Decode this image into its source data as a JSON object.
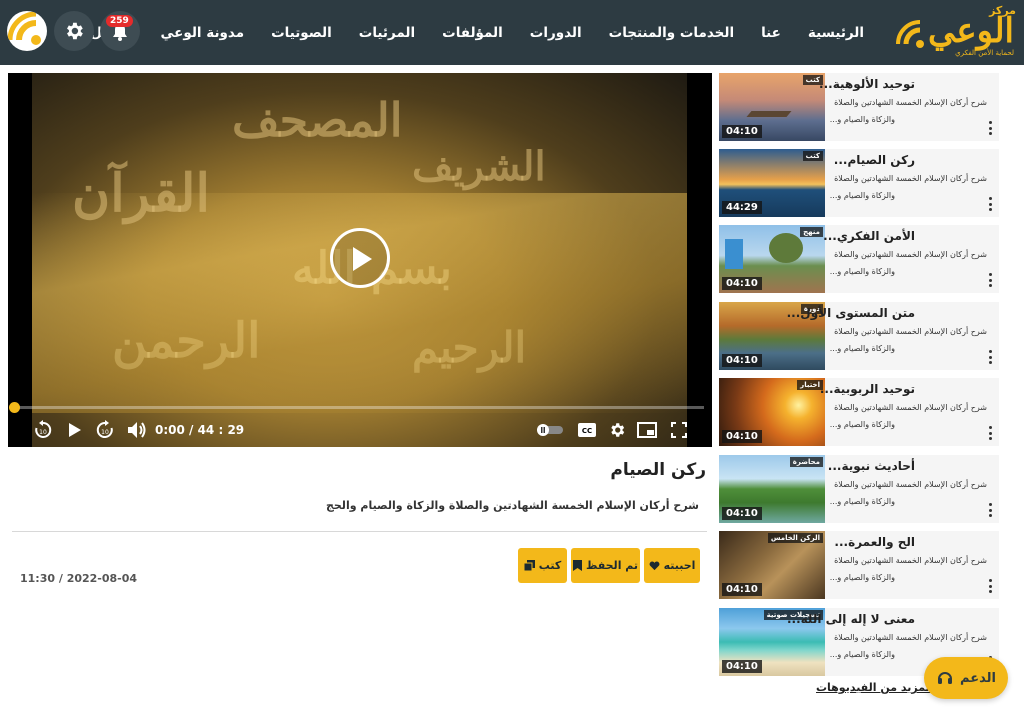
{
  "logo": {
    "center": "مركز",
    "name": "الوعي",
    "tagline": "لحماية الأمن الفكري"
  },
  "nav": [
    "الرئيسية",
    "عنا",
    "الخدمات والمنتجات",
    "الدورات",
    "المؤلفات",
    "المرئيات",
    "الصوتيات",
    "مدونة الوعي",
    "تواصل معنا"
  ],
  "notifications": {
    "count": "259"
  },
  "player": {
    "time": "0:00 / 44 : 29",
    "progress": 0.0
  },
  "video": {
    "title": "ركن الصيام",
    "description": "شرح أركان الإسلام الخمسة الشهادتين والصلاة والزكاة والصيام والحج",
    "date": "11:30 / 2022-08-04",
    "actions": {
      "like": "احببته",
      "saved": "تم الحفظ",
      "books": "كتب"
    }
  },
  "playlist": [
    {
      "title": "...توحيد الألوهية",
      "desc1": "شرح أركان الإسلام الخمسة الشهادتين والصلاة",
      "desc2": "...والزكاة والصيام و",
      "tag": "كتب",
      "duration": "04:10"
    },
    {
      "title": "...ركن الصيام",
      "desc1": "شرح أركان الإسلام الخمسة الشهادتين والصلاة",
      "desc2": "...والزكاة والصيام و",
      "tag": "كتب",
      "duration": "44:29"
    },
    {
      "title": "...الأمن الفكري",
      "desc1": "شرح أركان الإسلام الخمسة الشهادتين والصلاة",
      "desc2": "...والزكاة والصيام و",
      "tag": "منهج",
      "duration": "04:10"
    },
    {
      "title": "...متن المستوى الأول",
      "desc1": "شرح أركان الإسلام الخمسة الشهادتين والصلاة",
      "desc2": "...والزكاة والصيام و",
      "tag": "دورة",
      "duration": "04:10"
    },
    {
      "title": "...توحيد الربوبية",
      "desc1": "شرح أركان الإسلام الخمسة الشهادتين والصلاة",
      "desc2": "...والزكاة والصيام و",
      "tag": "اختبار",
      "duration": "04:10"
    },
    {
      "title": "...أحاديث نبوية",
      "desc1": "شرح أركان الإسلام الخمسة الشهادتين والصلاة",
      "desc2": "...والزكاة والصيام و",
      "tag": "محاضرة",
      "duration": "04:10"
    },
    {
      "title": "...الح والعمرة",
      "desc1": "شرح أركان الإسلام الخمسة الشهادتين والصلاة",
      "desc2": "...والزكاة والصيام و",
      "tag": "الركن الخامس",
      "duration": "04:10"
    },
    {
      "title": "...معنى لا إله إلى الله",
      "desc1": "شرح أركان الإسلام الخمسة الشهادتين والصلاة",
      "desc2": "...والزكاة والصيام و",
      "tag": "تسجيلات صوتية",
      "duration": "04:10"
    }
  ],
  "more_videos": "المزيد من الفيديوهات",
  "support": "الدعم",
  "colors": {
    "header": "#2d3b42",
    "accent": "#f3b81a",
    "badge": "#e52b2b"
  }
}
